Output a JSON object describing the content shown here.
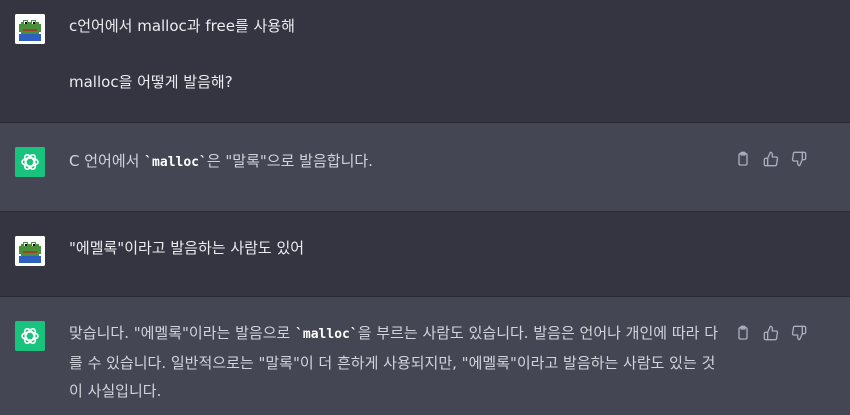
{
  "messages": [
    {
      "role": "user",
      "lines": [
        "c언어에서 malloc과 free를 사용해",
        "",
        "malloc을 어떻게 발음해?"
      ]
    },
    {
      "role": "assistant",
      "before": "C 언어에서 ",
      "code": "`malloc`",
      "after": "은 \"말록\"으로 발음합니다."
    },
    {
      "role": "user",
      "text": "\"에멜록\"이라고 발음하는 사람도 있어"
    },
    {
      "role": "assistant",
      "before": "맞습니다. \"에멜록\"이라는 발음으로 ",
      "code": "`malloc`",
      "after": "을 부르는 사람도 있습니다. 발음은 언어나 개인에 따라 다를 수 있습니다. 일반적으로는 \"말록\"이 더 흔하게 사용되지만, \"에멜록\"이라고 발음하는 사람도 있는 것이 사실입니다."
    }
  ],
  "icons": {
    "user_avatar": "pepe-frog-avatar",
    "assistant_avatar": "openai-logo",
    "copy": "clipboard-icon",
    "like": "thumbs-up-icon",
    "dislike": "thumbs-down-icon"
  },
  "colors": {
    "user_bg": "#343541",
    "assistant_bg": "#444654",
    "assistant_avatar_bg": "#19c37d"
  }
}
